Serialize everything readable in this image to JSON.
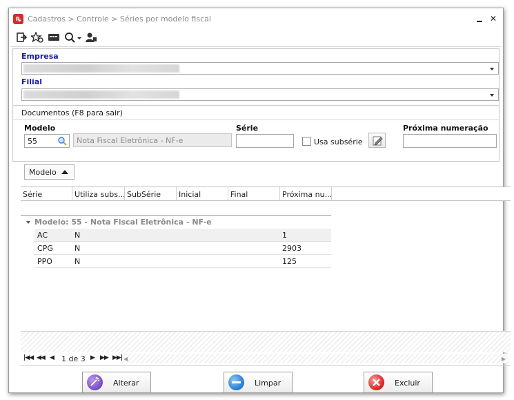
{
  "window": {
    "title": "Cadastros > Controle > Séries por modelo fiscal",
    "app_icon_glyph": "ꝶ",
    "close_glyph": "✕"
  },
  "toolbar": {
    "icons": [
      "exit-icon",
      "favorite-settings-icon",
      "card-reader-icon",
      "search-dropdown-icon",
      "user-icon"
    ]
  },
  "company": {
    "label": "Empresa",
    "value": ""
  },
  "branch": {
    "label": "Filial",
    "value": ""
  },
  "documents": {
    "title": "Documentos (F8 para sair)",
    "modelo_label": "Modelo",
    "modelo_value": "55",
    "modelo_description": "Nota Fiscal Eletrônica - NF-e",
    "serie_label": "Série",
    "serie_value": "",
    "subserie_label": "Usa subsérie",
    "subserie_checked": false,
    "next_label": "Próxima numeração",
    "next_value": ""
  },
  "group_by": {
    "label": "Modelo"
  },
  "grid": {
    "columns": [
      "Série",
      "Utiliza subs...",
      "SubSérie",
      "Inicial",
      "Final",
      "Próxima nu..."
    ],
    "group_label": "Modelo: 55 - Nota Fiscal Eletrônica - NF-e",
    "rows": [
      {
        "serie": "AC",
        "utiliza": "N",
        "subserie": "",
        "inicial": "",
        "final": "",
        "proxima": "1"
      },
      {
        "serie": "CPG",
        "utiliza": "N",
        "subserie": "",
        "inicial": "",
        "final": "",
        "proxima": "2903"
      },
      {
        "serie": "PPO",
        "utiliza": "N",
        "subserie": "",
        "inicial": "",
        "final": "",
        "proxima": "125"
      }
    ]
  },
  "pager": {
    "text": "1 de 3"
  },
  "actions": {
    "alterar": "Alterar",
    "limpar": "Limpar",
    "excluir": "Excluir"
  },
  "colors": {
    "label_blue": "#1a1aa8",
    "close_red": "#e02525",
    "clear_blue": "#2a7fd6",
    "edit_purple": "#7a4fc9"
  }
}
